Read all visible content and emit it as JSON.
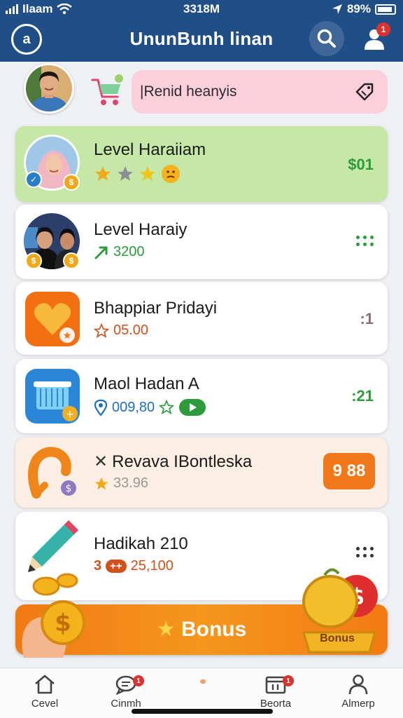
{
  "status_bar": {
    "carrier": "Ilaam",
    "time": "3318M",
    "battery": "89%"
  },
  "header": {
    "logo_letter": "a",
    "title": "UnunBunh linan",
    "profile_badge": "1"
  },
  "search": {
    "text": "|Renid heanyis"
  },
  "items": [
    {
      "title": "Level Haraiiam",
      "value": "$01",
      "background": "#c5e8a6"
    },
    {
      "title": "Level Haraiy",
      "subtitle": "3200",
      "subtitle_color": "#2c9b3c"
    },
    {
      "title": "Bhappiar Pridayi",
      "subtitle": "05.00",
      "right_text": ":1",
      "subtitle_color": "#d2501c"
    },
    {
      "title": "Maol Hadan A",
      "subtitle": "009,80",
      "right_text": ":21",
      "subtitle_color": "#1e6fc0"
    },
    {
      "title": "Revava IBontleska",
      "title_prefix": "✕",
      "subtitle": "33.96",
      "button_text": "9 88",
      "background": "#fbeee2",
      "subtitle_color": "#999999"
    },
    {
      "title": "Hadikah 210",
      "subtitle_prefix": "3",
      "subtitle_badge": "++",
      "subtitle": "25,100",
      "subtitle_color": "#d2501c"
    }
  ],
  "bonus": {
    "label": "Bonus",
    "medal_label": "Bonus",
    "colors": {
      "start": "#f07a12",
      "end": "#f27b12"
    }
  },
  "bottom_nav": [
    {
      "label": "Cevel",
      "icon": "home-icon"
    },
    {
      "label": "Cinmh",
      "icon": "chat-icon",
      "badge": "1"
    },
    {
      "label": "Beorta",
      "icon": "calendar-icon",
      "badge": "1"
    },
    {
      "label": "Almerp",
      "icon": "person-icon"
    }
  ],
  "colors": {
    "header": "#1f4f86",
    "accent_green": "#2c9b3c",
    "accent_orange": "#f07a12",
    "badge_red": "#e0302e"
  }
}
